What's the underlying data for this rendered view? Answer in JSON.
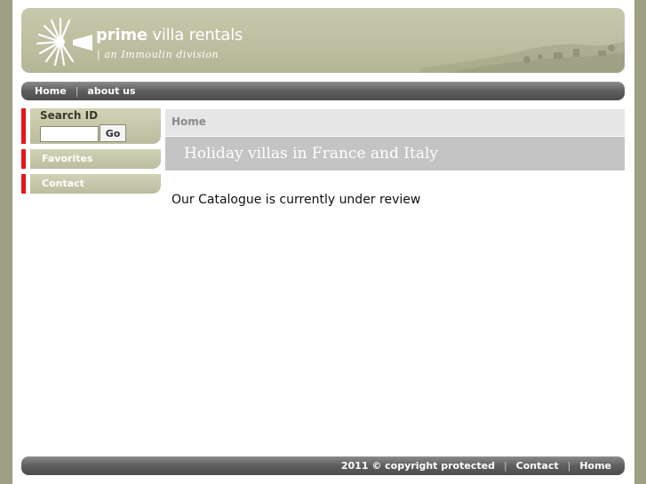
{
  "header": {
    "brand_bold": "prime",
    "brand_light": " villa rentals",
    "tagline": "| an Immoulin division"
  },
  "nav": {
    "home": "Home",
    "separator": "|",
    "about": "about us"
  },
  "sidebar": {
    "search_title": "Search ID",
    "search_value": "",
    "go_label": "Go",
    "favorites": "Favorites",
    "contact": "Contact"
  },
  "main": {
    "breadcrumb": "Home",
    "banner": "Holiday villas in France and Italy",
    "notice": "Our Catalogue is currently under review"
  },
  "footer": {
    "copyright": "2011 © copyright protected",
    "separator": "|",
    "contact": "Contact",
    "home": "Home"
  },
  "colors": {
    "accent_red": "#e8151b",
    "header_olive": "#c8c8ac",
    "nav_gray": "#5e5e5e",
    "outer_bg": "#9e9e82"
  }
}
